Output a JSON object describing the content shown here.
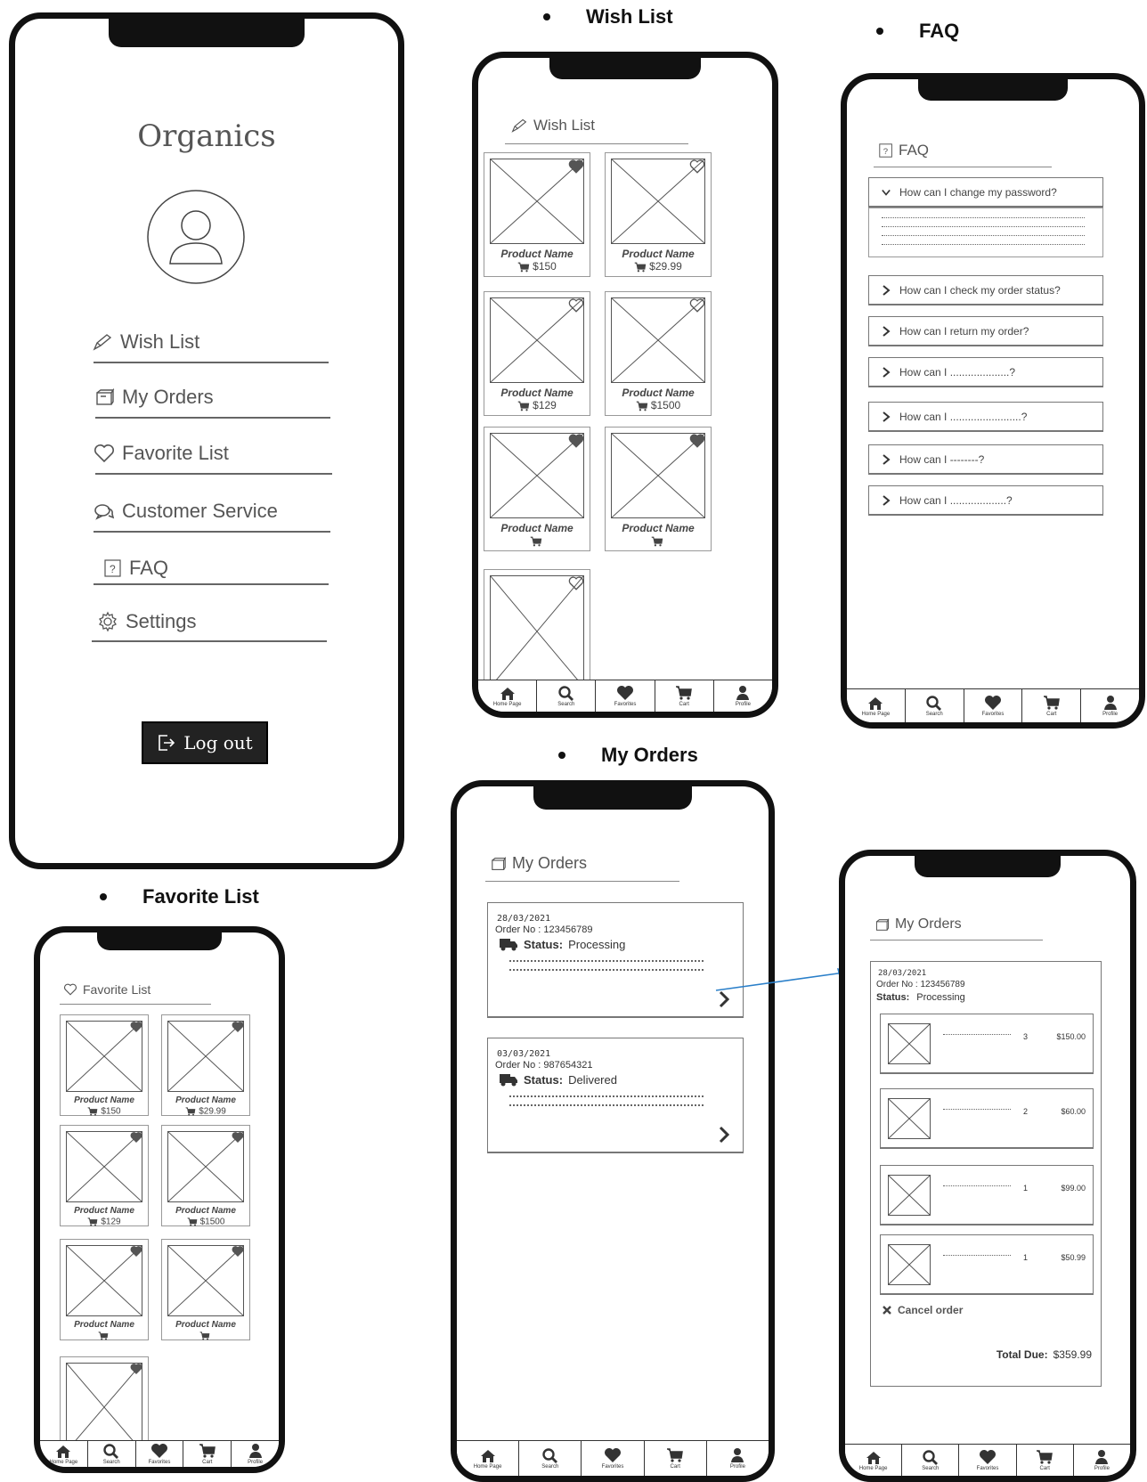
{
  "headings": {
    "wish_list": "Wish List",
    "faq": "FAQ",
    "my_orders": "My Orders",
    "favorite_list": "Favorite List"
  },
  "profile_screen": {
    "app_name": "Organics",
    "avatar_icon": "user-avatar-icon",
    "menu": [
      {
        "label": "Wish List",
        "icon": "pencil-icon"
      },
      {
        "label": "My Orders",
        "icon": "box-icon"
      },
      {
        "label": "Favorite List",
        "icon": "heart-outline-icon"
      },
      {
        "label": "Customer Service",
        "icon": "chat-icon"
      },
      {
        "label": "FAQ",
        "icon": "question-box-icon"
      },
      {
        "label": "Settings",
        "icon": "gear-icon"
      }
    ],
    "logout_label": "Log out"
  },
  "wish_list_screen": {
    "title": "Wish List",
    "products": [
      {
        "name": "Product Name",
        "price": "$150",
        "heart": "filled"
      },
      {
        "name": "Product Name",
        "price": "$29.99",
        "heart": "outline"
      },
      {
        "name": "Product Name",
        "price": "$129",
        "heart": "outline"
      },
      {
        "name": "Product Name",
        "price": "$1500",
        "heart": "outline"
      },
      {
        "name": "Product Name",
        "price": "",
        "heart": "filled"
      },
      {
        "name": "Product Name",
        "price": "",
        "heart": "filled"
      },
      {
        "name": "",
        "price": "",
        "heart": "outline"
      }
    ]
  },
  "faq_screen": {
    "title": "FAQ",
    "questions": [
      {
        "q": "How can I change my password?",
        "expanded": true
      },
      {
        "q": "How can I check my order status?",
        "expanded": false
      },
      {
        "q": "How can I return my order?",
        "expanded": false
      },
      {
        "q": "How can I ....................?",
        "expanded": false
      },
      {
        "q": "How can I ........................?",
        "expanded": false
      },
      {
        "q": "How can I --------?",
        "expanded": false
      },
      {
        "q": "How can I ...................?",
        "expanded": false
      }
    ]
  },
  "favorite_list_screen": {
    "title": "Favorite List",
    "products": [
      {
        "name": "Product Name",
        "price": "$150"
      },
      {
        "name": "Product Name",
        "price": "$29.99"
      },
      {
        "name": "Product Name",
        "price": "$129"
      },
      {
        "name": "Product Name",
        "price": "$1500"
      },
      {
        "name": "Product Name",
        "price": ""
      },
      {
        "name": "Product Name",
        "price": ""
      },
      {
        "name": "",
        "price": ""
      }
    ]
  },
  "orders_screen": {
    "title": "My Orders",
    "orders": [
      {
        "date": "28/03/2021",
        "order_no": "Order No : 123456789",
        "status_label": "Status:",
        "status": "Processing"
      },
      {
        "date": "03/03/2021",
        "order_no": "Order No : 987654321",
        "status_label": "Status:",
        "status": "Delivered"
      }
    ]
  },
  "order_detail_screen": {
    "title": "My Orders",
    "date": "28/03/2021",
    "order_no": "Order No : 123456789",
    "status_label": "Status:",
    "status": "Processing",
    "items": [
      {
        "qty": "3",
        "price": "$150.00"
      },
      {
        "qty": "2",
        "price": "$60.00"
      },
      {
        "qty": "1",
        "price": "$99.00"
      },
      {
        "qty": "1",
        "price": "$50.99"
      }
    ],
    "cancel_label": "Cancel order",
    "total_label": "Total Due:",
    "total_value": "$359.99"
  },
  "navbar": [
    {
      "label": "Home Page",
      "icon": "home-icon"
    },
    {
      "label": "Search",
      "icon": "search-icon"
    },
    {
      "label": "Favorites",
      "icon": "heart-icon"
    },
    {
      "label": "Cart",
      "icon": "cart-icon"
    },
    {
      "label": "Profile",
      "icon": "profile-icon"
    }
  ],
  "colors": {
    "frame": "#111111",
    "arrow": "#2a7fc9",
    "text": "#444444"
  }
}
